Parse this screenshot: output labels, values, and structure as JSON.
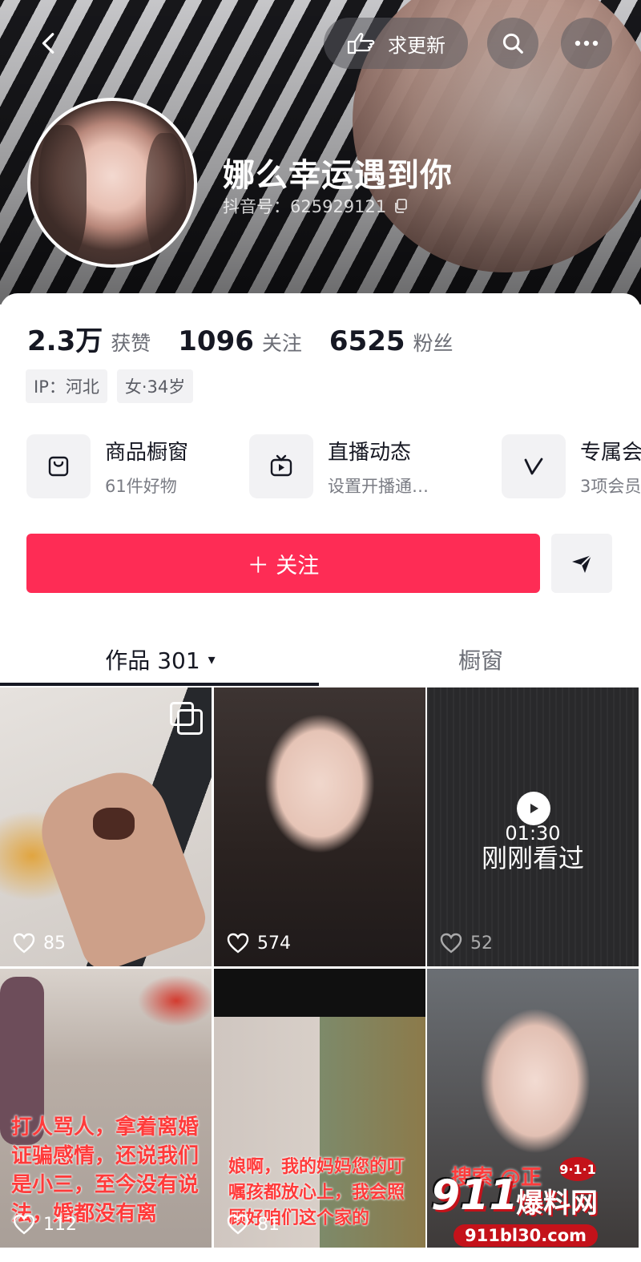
{
  "header": {
    "update_label": "求更新",
    "nickname": "娜么幸运遇到你",
    "douyin_id": "抖音号：625929121"
  },
  "stats": [
    {
      "value": "2.3万",
      "label": "获赞"
    },
    {
      "value": "1096",
      "label": "关注"
    },
    {
      "value": "6525",
      "label": "粉丝"
    }
  ],
  "tags": [
    "IP：河北",
    "女·34岁"
  ],
  "shortcuts": [
    {
      "title": "商品橱窗",
      "subtitle": "61件好物",
      "icon": "shopping-bag-icon"
    },
    {
      "title": "直播动态",
      "subtitle": "设置开播通…",
      "icon": "tv-icon"
    },
    {
      "title": "专属会",
      "subtitle": "3项会员",
      "icon": "v-badge-icon"
    }
  ],
  "actions": {
    "follow_label": "＋ 关注",
    "share_icon": "send-icon"
  },
  "tabs": {
    "works_label": "作品 301",
    "works_caret": "▾",
    "window_label": "橱窗"
  },
  "grid": [
    {
      "likes": "85"
    },
    {
      "likes": "574"
    },
    {
      "likes": "52",
      "duration": "01:30",
      "overlay": "刚刚看过"
    },
    {
      "likes": "112",
      "caption": "打人骂人，拿着离婚证骗感情，还说我们是小三，至今没有说法，婚都没有离"
    },
    {
      "likes": "81",
      "caption": "娘啊，我的妈妈您的叮嘱孩都放心上，我会照顾好咱们这个家的"
    },
    {
      "caption": "搜索 @正"
    }
  ],
  "watermark": {
    "brand": "911",
    "name": "爆料网",
    "badge": "9·1·1",
    "url": "911bl30.com"
  },
  "colors": {
    "accent": "#fe2c55",
    "text": "#161823",
    "muted": "#6b6d75"
  }
}
